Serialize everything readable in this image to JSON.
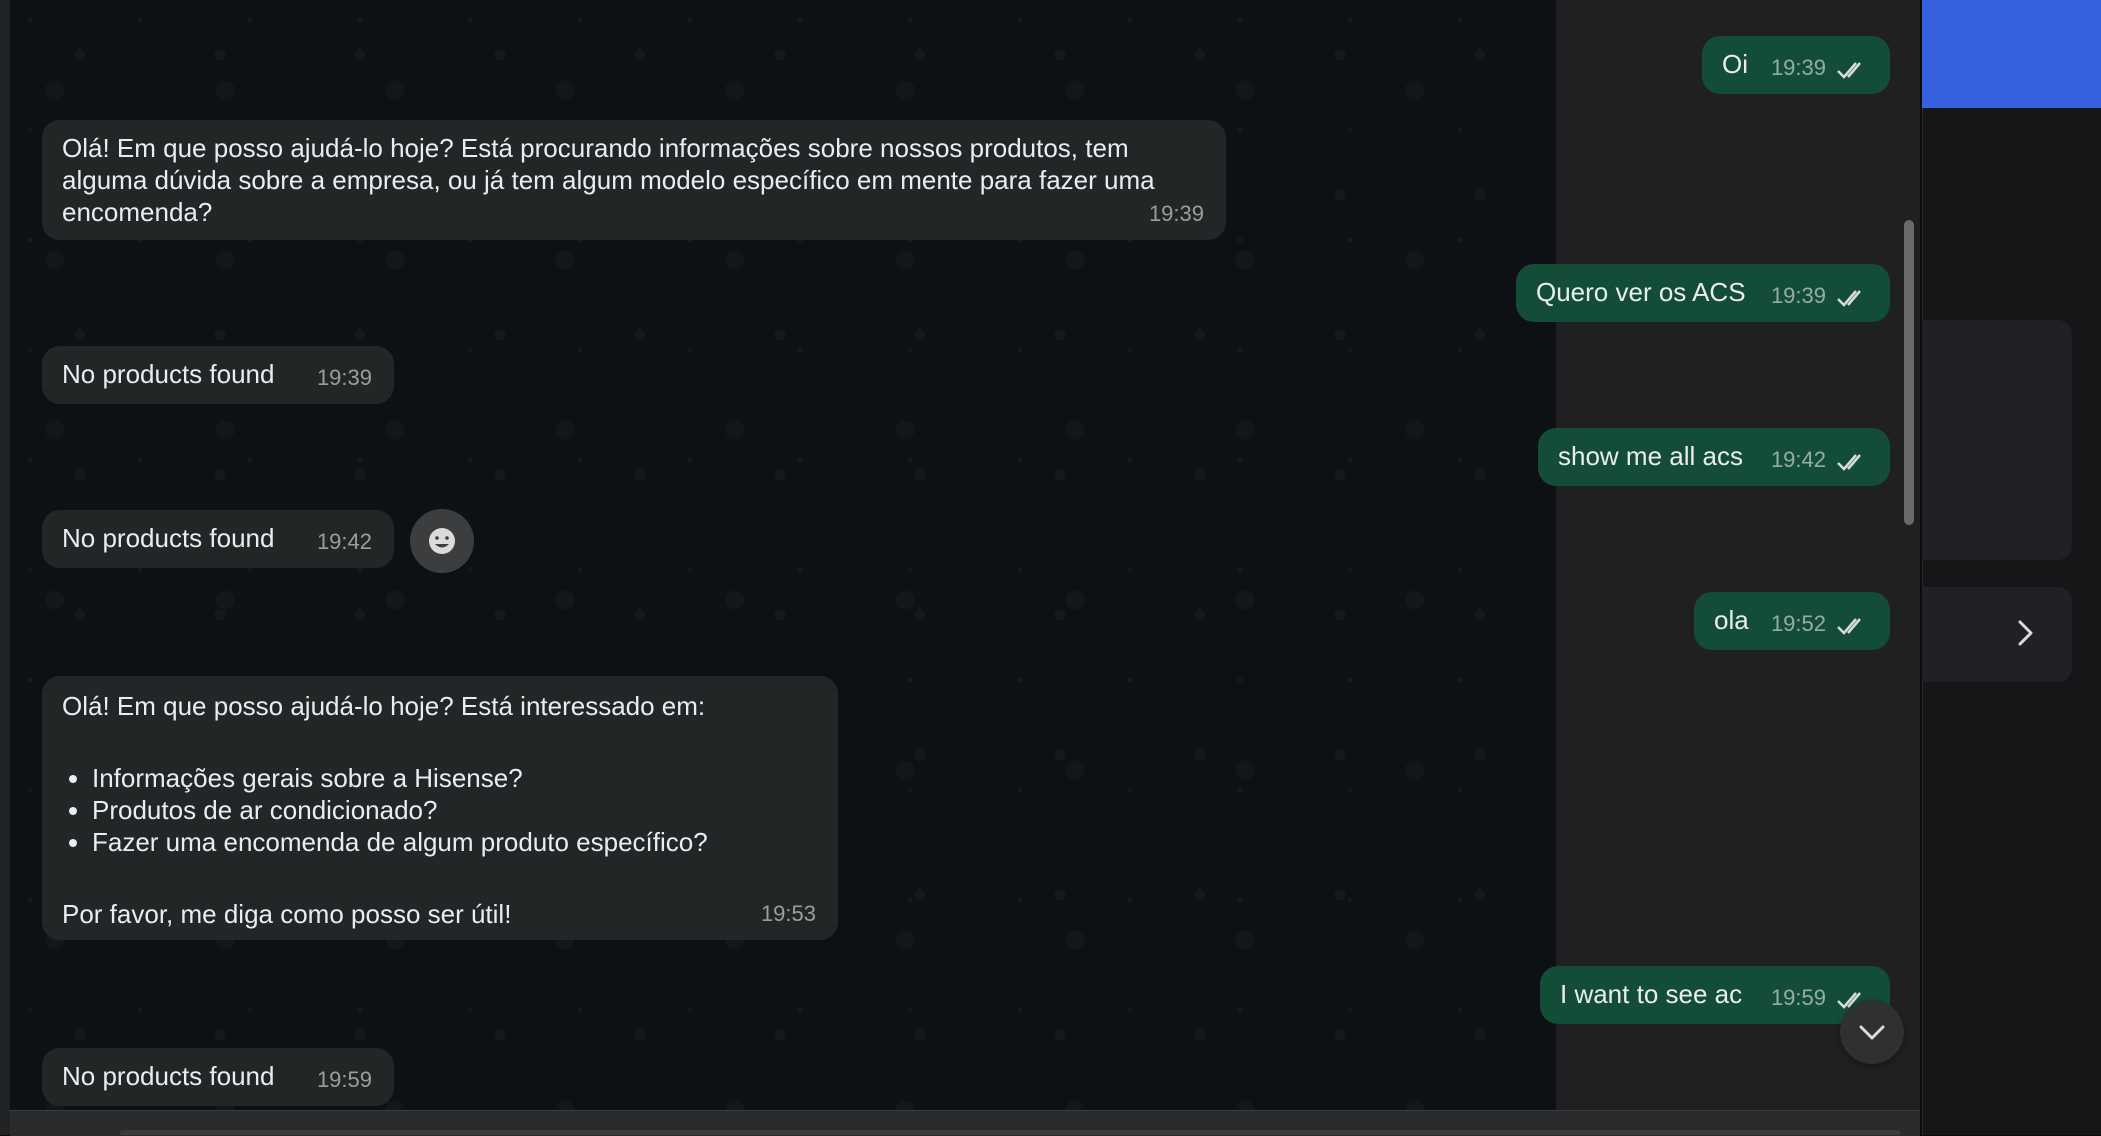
{
  "messages": {
    "in": [
      {
        "text": "Olá! Em que posso ajudá-lo hoje? Está procurando informações sobre nossos produtos, tem alguma dúvida sobre a empresa, ou já tem algum modelo específico em mente para fazer uma encomenda?",
        "time": "19:39"
      },
      {
        "text": "No products found",
        "time": "19:39"
      },
      {
        "text": "No products found",
        "time": "19:42"
      },
      {
        "intro": "Olá! Em que posso ajudá-lo hoje? Está interessado em:",
        "bullets": [
          "Informações gerais sobre a Hisense?",
          "Produtos de ar condicionado?",
          "Fazer uma encomenda de algum produto específico?"
        ],
        "outro": "Por favor, me diga como posso ser útil!",
        "time": "19:53"
      },
      {
        "text": "No products found",
        "time": "19:59"
      }
    ],
    "out": [
      {
        "text": "Oi",
        "time": "19:39"
      },
      {
        "text": "Quero ver os ACS",
        "time": "19:39"
      },
      {
        "text": "show me all acs",
        "time": "19:42"
      },
      {
        "text": "ola",
        "time": "19:52"
      },
      {
        "text": "I want to see ac",
        "time": "19:59"
      }
    ]
  },
  "icons": {
    "read_receipt": "double-check-icon",
    "reaction": "smiley-icon",
    "scroll_down": "chevron-down-icon",
    "side_arrow": "chevron-right-icon"
  },
  "colors": {
    "outgoing_bubble": "#144d37",
    "incoming_bubble": "#232627",
    "accent_blue": "#3761e0"
  }
}
